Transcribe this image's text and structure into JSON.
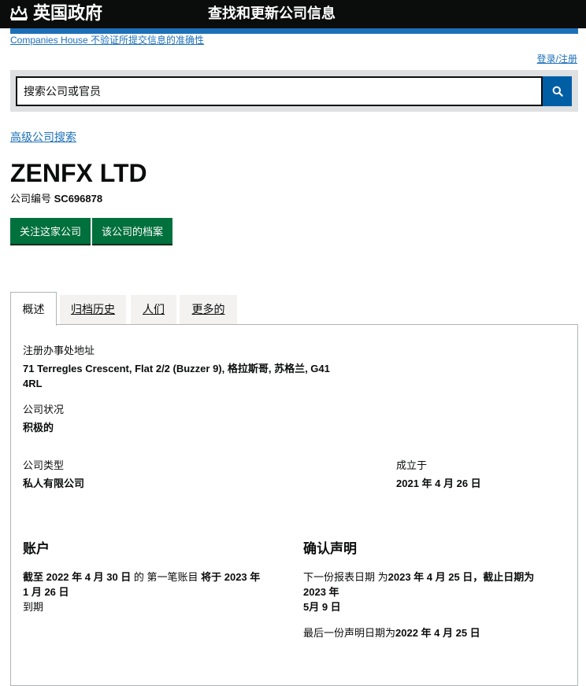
{
  "header": {
    "gov_logo": "英国政府",
    "service_name": "查找和更新公司信息"
  },
  "disclaimer": "Companies House 不验证所提交信息的准确性",
  "signin": "登录/注册",
  "search": {
    "placeholder": "搜索公司或官员"
  },
  "advanced_search": "高级公司搜索",
  "company": {
    "name": "ZENFX LTD",
    "number_label": "公司编号",
    "number": "SC696878"
  },
  "actions": {
    "follow": "关注这家公司",
    "filing": "该公司的档案"
  },
  "tabs": [
    {
      "label": "概述",
      "active": true
    },
    {
      "label": "归档历史",
      "active": false
    },
    {
      "label": "人们",
      "active": false
    },
    {
      "label": "更多的",
      "active": false
    }
  ],
  "overview": {
    "registered_office_label": "注册办事处地址",
    "registered_office_line1": "71 Terregles Crescent, Flat 2/2 (Buzzer 9), 格拉斯哥, 苏格兰, G41",
    "registered_office_line2": "4RL",
    "status_label": "公司状况",
    "status_value": "积极的",
    "type_label": "公司类型",
    "type_value": "私人有限公司",
    "incorporated_label": "成立于",
    "incorporated_value": "2021 年 4 月 26 日"
  },
  "accounts": {
    "title": "账户",
    "line1_a": "截至 2022 年 4 月 30 日",
    "line1_b": " 的 第一笔账目 ",
    "line1_c": "将于 2023 年",
    "line2": "1 月 26 日",
    "line3": "到期"
  },
  "confirmation": {
    "title": "确认声明",
    "line1_a": "下一份报表日期 为",
    "line1_b": "2023 年 4 月 25 日，截止日期为",
    "line2": "2023 年",
    "line3": "5月 9 日",
    "last_a": "最后一份声明日期为",
    "last_b": "2022 年 4 月 25 日"
  }
}
